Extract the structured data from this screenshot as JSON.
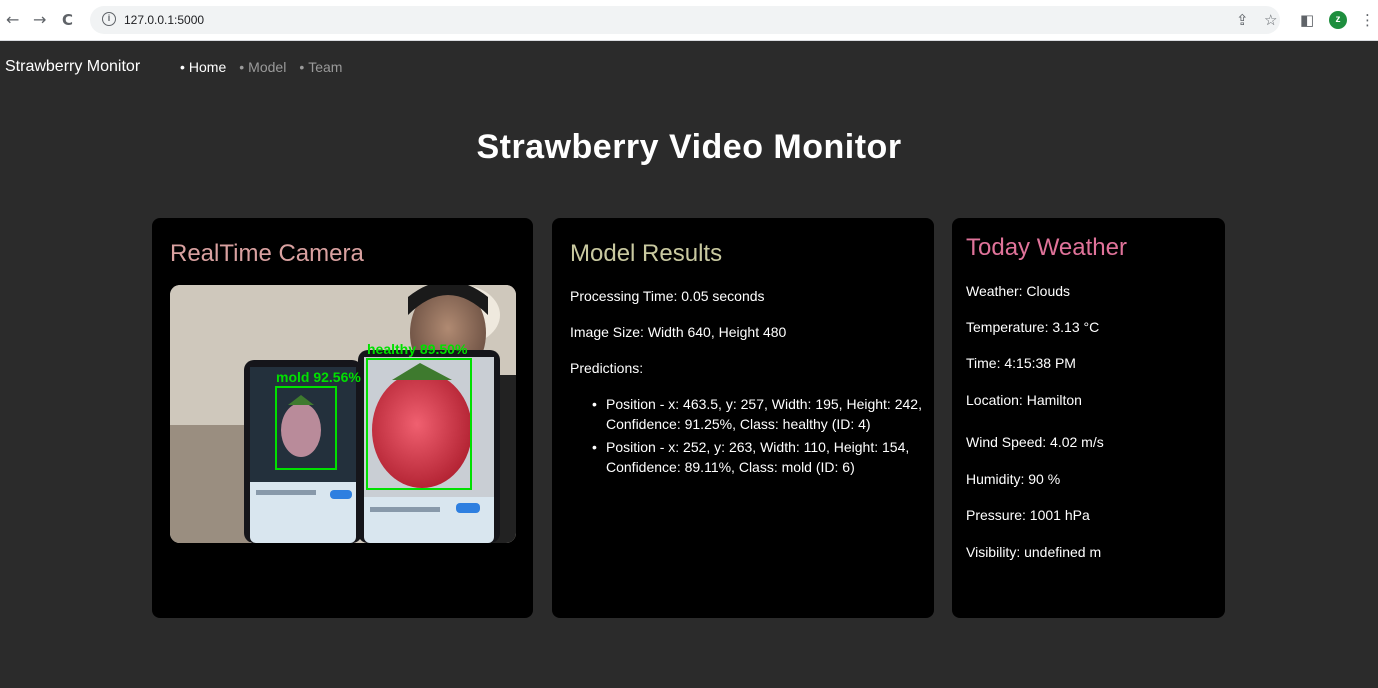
{
  "browser": {
    "url": "127.0.0.1:5000",
    "back_icon": "←",
    "forward_icon": "→",
    "reload_icon": "C",
    "info_icon": "i",
    "share_icon": "⇪",
    "star_icon": "☆",
    "sidepanel_icon": "◧",
    "avatar_letter": "z",
    "menu_icon": "⋮"
  },
  "nav": {
    "brand": "Strawberry Monitor",
    "items": [
      {
        "label": "Home",
        "active": true
      },
      {
        "label": "Model",
        "active": false
      },
      {
        "label": "Team",
        "active": false
      }
    ]
  },
  "page_title": "Strawberry Video Monitor",
  "camera": {
    "title": "RealTime Camera",
    "detections": [
      {
        "label": "mold",
        "confidence": "92.56%"
      },
      {
        "label": "healthy",
        "confidence": "89.50%"
      }
    ]
  },
  "model": {
    "title": "Model Results",
    "processing_time": "Processing Time: 0.05 seconds",
    "image_size": "Image Size: Width 640, Height 480",
    "predictions_label": "Predictions:",
    "predictions": [
      "Position - x: 463.5, y: 257, Width: 195, Height: 242, Confidence: 91.25%, Class: healthy (ID: 4)",
      "Position - x: 252, y: 263, Width: 110, Height: 154, Confidence: 89.11%, Class: mold (ID: 6)"
    ]
  },
  "weather": {
    "title": "Today Weather",
    "weather": "Weather: Clouds",
    "temperature": "Temperature: 3.13 °C",
    "time": "Time: 4:15:38 PM",
    "location": "Location: Hamilton",
    "wind_speed": "Wind Speed: 4.02 m/s",
    "humidity": "Humidity: 90 %",
    "pressure": "Pressure: 1001 hPa",
    "visibility": "Visibility: undefined m"
  },
  "colors": {
    "page_bg": "#2b2b2b",
    "card_bg": "#000000",
    "detection_box": "#00e000",
    "camera_title": "#d9a1a0",
    "model_title": "#c9c9a0",
    "weather_title": "#e0739a"
  }
}
